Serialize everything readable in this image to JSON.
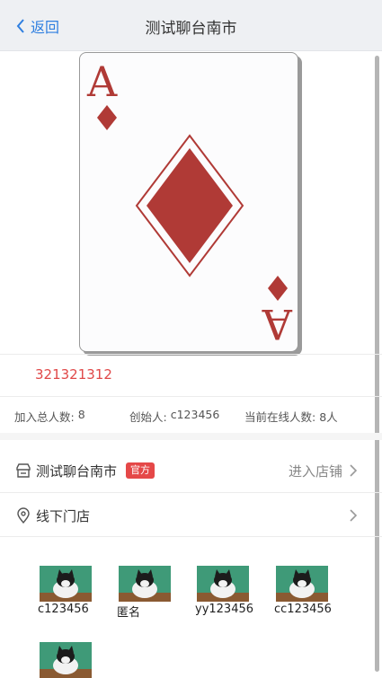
{
  "nav": {
    "back_label": "返回",
    "title": "测试聊台南市"
  },
  "card": {
    "rank": "A",
    "suit": "diamond",
    "color": "#b03a36"
  },
  "room": {
    "id": "321321312"
  },
  "stats": [
    {
      "key": "加入总人数:",
      "value": "8"
    },
    {
      "key": "创始人:",
      "value": "c123456"
    },
    {
      "key": "当前在线人数:",
      "value": "8人"
    }
  ],
  "store_row": {
    "name": "测试聊台南市",
    "badge": "官方",
    "action": "进入店铺"
  },
  "offline_row": {
    "label": "线下门店"
  },
  "members": [
    {
      "name": "c123456"
    },
    {
      "name": "匿名"
    },
    {
      "name": "yy123456"
    },
    {
      "name": "cc123456"
    },
    {
      "name": ""
    }
  ],
  "colors": {
    "accent": "#2f7fe0",
    "danger": "#e04848",
    "badge": "#e54848"
  }
}
